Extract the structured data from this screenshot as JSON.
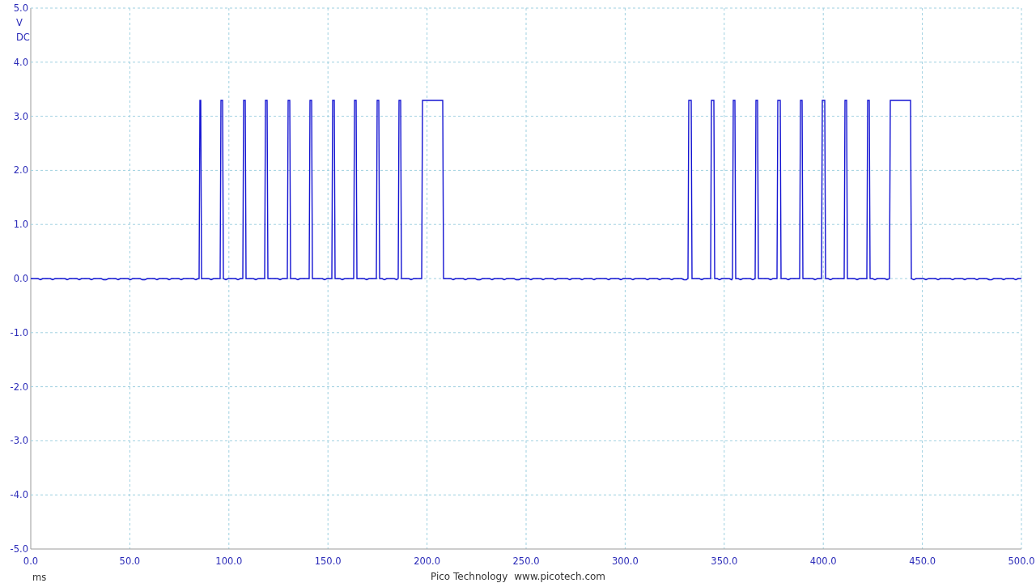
{
  "y_axis": {
    "unit": "V",
    "coupling": "DC",
    "ticks": [
      "5.0",
      "4.0",
      "3.0",
      "2.0",
      "1.0",
      "0.0",
      "-1.0",
      "-2.0",
      "-3.0",
      "-4.0",
      "-5.0"
    ]
  },
  "x_axis": {
    "unit": "ms",
    "ticks": [
      "0.0",
      "50.0",
      "100.0",
      "150.0",
      "200.0",
      "250.0",
      "300.0",
      "350.0",
      "400.0",
      "450.0",
      "500.0"
    ]
  },
  "footer": {
    "company": "Pico Technology",
    "website": "www.picotech.com"
  }
}
